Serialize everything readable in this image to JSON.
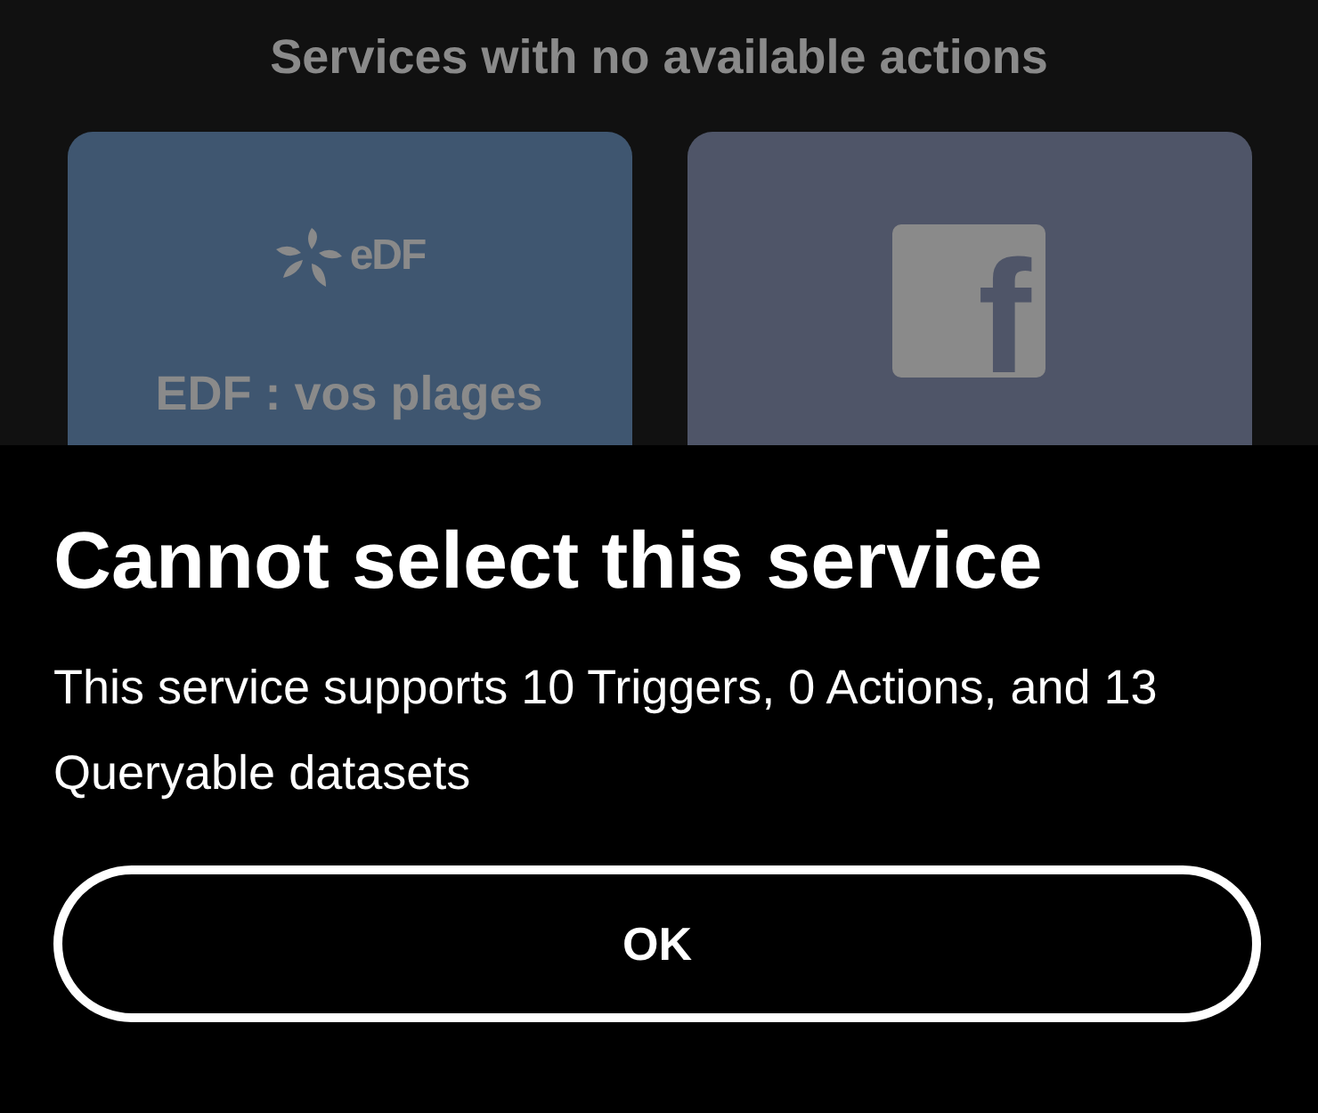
{
  "section_title": "Services with no available actions",
  "services": [
    {
      "kind": "edf",
      "logo_text": "eDF",
      "name": "EDF : vos plages"
    },
    {
      "kind": "facebook",
      "logo_text": "f"
    }
  ],
  "dialog": {
    "title": "Cannot select this service",
    "message": "This service supports 10 Triggers, 0 Actions, and 13 Queryable datasets",
    "button": "OK"
  }
}
